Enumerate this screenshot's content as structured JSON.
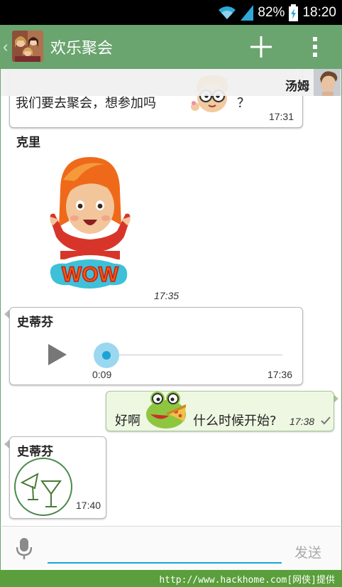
{
  "status_bar": {
    "battery": "82%",
    "time": "18:20"
  },
  "header": {
    "back_icon": "chevron-left-icon",
    "title": "欢乐聚会",
    "add_icon": "plus-icon",
    "menu_icon": "overflow-menu-icon"
  },
  "messages": [
    {
      "sender": "汤姆",
      "text_before": "我们要去聚会，想参加吗",
      "text_after": "？",
      "time": "17:31",
      "sticker": "nerd-boy-sticker"
    },
    {
      "sender": "克里",
      "sticker": "wow-girl-sticker",
      "sticker_text": "WOW",
      "time": "17:35"
    },
    {
      "sender": "史蒂芬",
      "type": "audio",
      "elapsed": "0:09",
      "time": "17:36",
      "progress": 0.05
    },
    {
      "text_before": "好啊",
      "text_after": "什么时候开始?",
      "time": "17:38",
      "sticker": "frog-pizza-sticker",
      "status_icon": "check-icon"
    },
    {
      "sender": "史蒂芬",
      "sticker": "cheers-glasses-sticker",
      "time": "17:40"
    }
  ],
  "input": {
    "value": "",
    "placeholder": "",
    "send_label": "发送",
    "mic_icon": "microphone-icon"
  },
  "watermark": "http://www.hackhome.com[网侠]提供",
  "colors": {
    "action_bar": "#6aa46e",
    "accent": "#1ba3d6",
    "outgoing_bubble": "#eef7e1",
    "watermark_bar": "#5a9f3b"
  }
}
